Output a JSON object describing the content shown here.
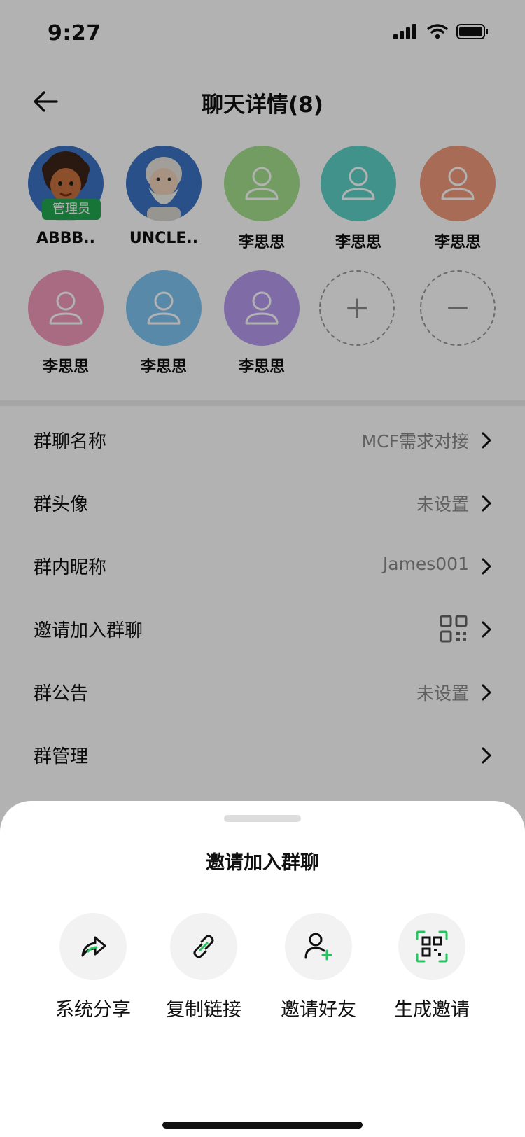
{
  "status_bar": {
    "time": "9:27"
  },
  "nav": {
    "title": "聊天详情(8)"
  },
  "members": [
    {
      "name": "ABBB..",
      "badge": "管理员",
      "avatar_color": "#3b73c4"
    },
    {
      "name": "UNCLE..",
      "avatar_color": "#3b73c4"
    },
    {
      "name": "李思思",
      "avatar_color": "#a4e08d"
    },
    {
      "name": "李思思",
      "avatar_color": "#5fd1c9"
    },
    {
      "name": "李思思",
      "avatar_color": "#f19a7b"
    },
    {
      "name": "李思思",
      "avatar_color": "#f19abb"
    },
    {
      "name": "李思思",
      "avatar_color": "#80c4f2"
    },
    {
      "name": "李思思",
      "avatar_color": "#b79bf0"
    }
  ],
  "member_controls": {
    "add": "+",
    "remove": "−"
  },
  "settings": [
    {
      "label": "群聊名称",
      "value": "MCF需求对接"
    },
    {
      "label": "群头像",
      "value": "未设置"
    },
    {
      "label": "群内昵称",
      "value": "James001"
    },
    {
      "label": "邀请加入群聊",
      "value": ""
    },
    {
      "label": "群公告",
      "value": "未设置"
    },
    {
      "label": "群管理",
      "value": ""
    }
  ],
  "sheet": {
    "title": "邀请加入群聊",
    "actions": [
      {
        "label": "系统分享",
        "icon": "share-icon"
      },
      {
        "label": "复制链接",
        "icon": "link-icon"
      },
      {
        "label": "邀请好友",
        "icon": "add-friend-icon"
      },
      {
        "label": "生成邀请",
        "icon": "qr-code-icon"
      }
    ]
  },
  "colors": {
    "accent": "#22c55e",
    "badge": "#22a84f",
    "overlay": "rgba(0,0,0,0.30)"
  }
}
